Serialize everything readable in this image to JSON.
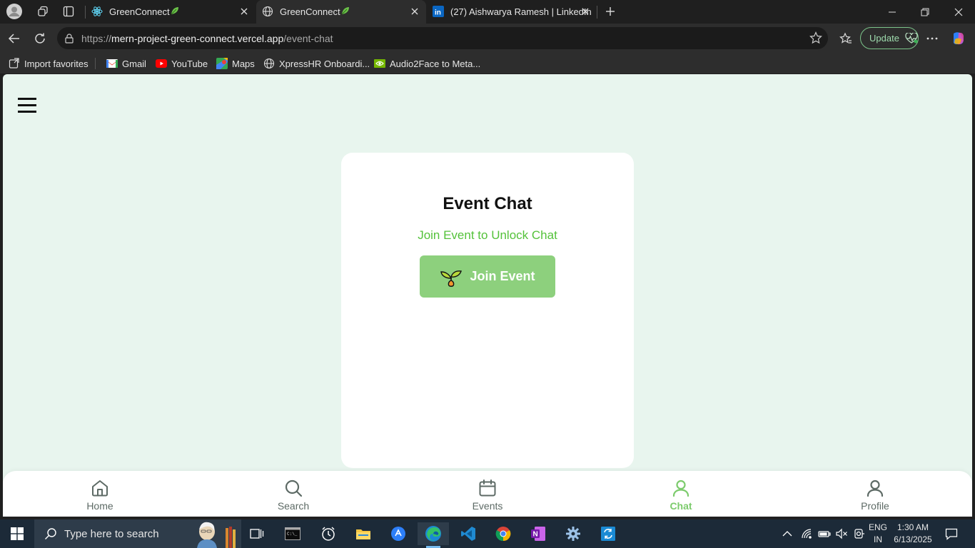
{
  "browser": {
    "tabs": [
      {
        "title": "GreenConnect",
        "icon": "react-icon",
        "active": false
      },
      {
        "title": "GreenConnect",
        "icon": "globe-icon",
        "active": true
      },
      {
        "title": "(27) Aishwarya Ramesh | LinkedIn",
        "icon": "linkedin-icon",
        "active": false
      }
    ],
    "url": {
      "scheme": "https://",
      "host": "mern-project-green-connect.vercel.app",
      "path": "/event-chat"
    },
    "update_label": "Update",
    "favorites": [
      {
        "label": "Import favorites",
        "icon": "import-icon"
      },
      {
        "label": "Gmail",
        "icon": "gmail-icon"
      },
      {
        "label": "YouTube",
        "icon": "youtube-icon"
      },
      {
        "label": "Maps",
        "icon": "maps-icon"
      },
      {
        "label": "XpressHR Onboardi...",
        "icon": "globe-icon"
      },
      {
        "label": "Audio2Face to Meta...",
        "icon": "nvidia-icon"
      }
    ]
  },
  "page": {
    "card": {
      "title": "Event Chat",
      "subtitle": "Join Event to Unlock Chat",
      "join_button": "Join Event"
    },
    "bottom_nav": [
      {
        "label": "Home",
        "icon": "home-icon",
        "active": false
      },
      {
        "label": "Search",
        "icon": "search-icon",
        "active": false
      },
      {
        "label": "Events",
        "icon": "calendar-icon",
        "active": false
      },
      {
        "label": "Chat",
        "icon": "user-icon",
        "active": true
      },
      {
        "label": "Profile",
        "icon": "user-icon",
        "active": false
      }
    ],
    "colors": {
      "background": "#e8f5ee",
      "accent": "#7ccb6c",
      "button": "#8dd07d",
      "subtitle": "#54c23a"
    }
  },
  "taskbar": {
    "search_placeholder": "Type here to search",
    "lang_line1": "ENG",
    "lang_line2": "IN",
    "time": "1:30 AM",
    "date": "6/13/2025"
  }
}
